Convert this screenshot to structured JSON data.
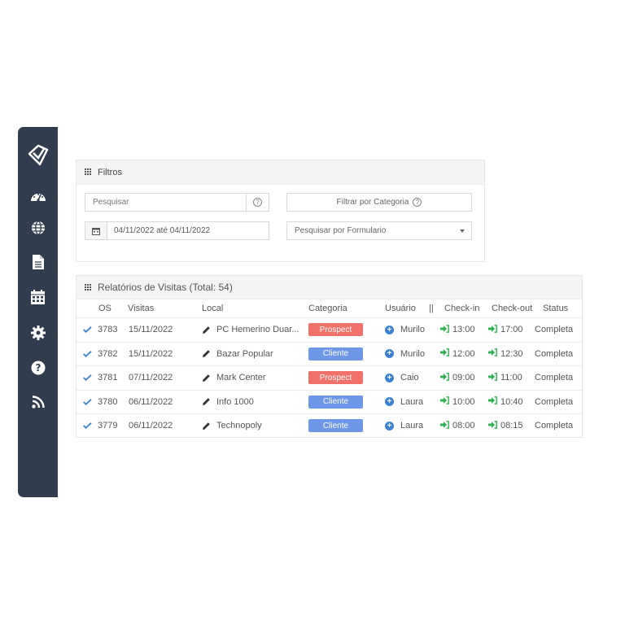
{
  "sidebar": {
    "items": [
      {
        "icon": "logo-icon"
      },
      {
        "icon": "dashboard-gauge-icon"
      },
      {
        "icon": "globe-icon"
      },
      {
        "icon": "document-icon"
      },
      {
        "icon": "calendar-icon"
      },
      {
        "icon": "gear-icon"
      },
      {
        "icon": "help-icon"
      },
      {
        "icon": "rss-feed-icon"
      }
    ],
    "bg_color": "#2f3d4f"
  },
  "filters": {
    "title": "Filtros",
    "search_placeholder": "Pesquisar",
    "category_button": "Filtrar por Categoria",
    "date_range": "04/11/2022 até 04/11/2022",
    "form_select": "Pesquisar por Formulario",
    "help_glyph": "?"
  },
  "reports": {
    "title": "Relatórios de Visitas (Total: 54)",
    "columns": {
      "os": "OS",
      "visitas": "Visitas",
      "local": "Local",
      "categoria": "Categoria",
      "usuario": "Usuário",
      "sep": "||",
      "checkin": "Check-in",
      "checkout": "Check-out",
      "status": "Status"
    },
    "rows": [
      {
        "os": "3783",
        "visita": "15/11/2022",
        "local": "PC Hemerino Duar...",
        "categoria": "Prospect",
        "usuario": "Murilo",
        "checkin": "13:00",
        "checkout": "17:00",
        "status": "Completa"
      },
      {
        "os": "3782",
        "visita": "15/11/2022",
        "local": "Bazar Popular",
        "categoria": "Cliente",
        "usuario": "Murilo",
        "checkin": "12:00",
        "checkout": "12:30",
        "status": "Completa"
      },
      {
        "os": "3781",
        "visita": "07/11/2022",
        "local": "Mark Center",
        "categoria": "Prospect",
        "usuario": "Caio",
        "checkin": "09:00",
        "checkout": "11:00",
        "status": "Completa"
      },
      {
        "os": "3780",
        "visita": "06/11/2022",
        "local": "Info 1000",
        "categoria": "Cliente",
        "usuario": "Laura",
        "checkin": "10:00",
        "checkout": "10:40",
        "status": "Completa"
      },
      {
        "os": "3779",
        "visita": "06/11/2022",
        "local": "Technopoly",
        "categoria": "Cliente",
        "usuario": "Laura",
        "checkin": "08:00",
        "checkout": "08:15",
        "status": "Completa"
      }
    ]
  },
  "colors": {
    "prospect": "#f0706a",
    "cliente": "#6f97e8",
    "user_plus": "#3b82d6",
    "checkin_green": "#2bb24c",
    "check_blue": "#3b82d6"
  },
  "glyphs": {
    "plus": "+"
  }
}
